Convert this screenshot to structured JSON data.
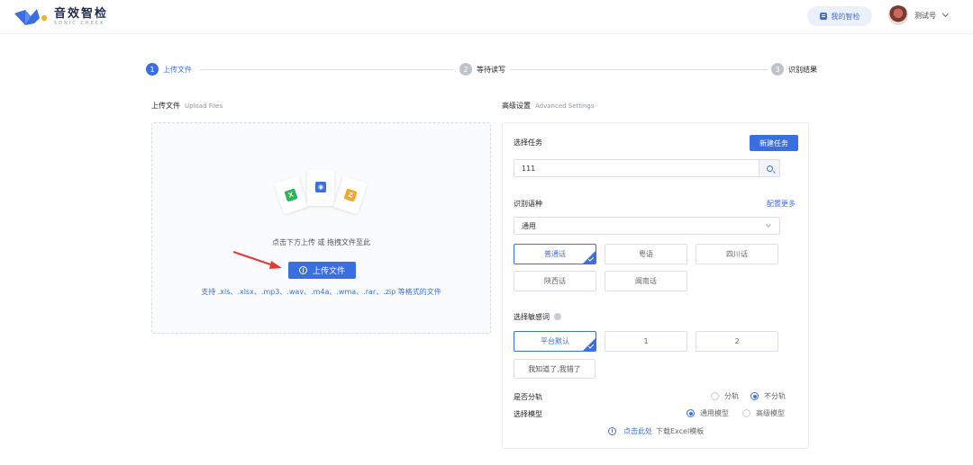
{
  "header": {
    "logo_cn": "音效智检",
    "logo_en": "SONIC CHECK",
    "my_check_label": "我的智检",
    "user_name": "测试号"
  },
  "steps": [
    {
      "num": "1",
      "label": "上传文件",
      "active": true
    },
    {
      "num": "2",
      "label": "等待读写",
      "active": false
    },
    {
      "num": "3",
      "label": "识别结果",
      "active": false
    }
  ],
  "upload": {
    "title": "上传文件",
    "title_en": "Upload Files",
    "hint": "点击下方上传 或 拖拽文件至此",
    "button_label": "上传文件",
    "formats": "支持 .xls、.xlsx、.mp3、.wav、.m4a、.wma、.rar、.zip 等格式的文件",
    "file_badges": [
      "X",
      "◉",
      "Z"
    ]
  },
  "advanced": {
    "title": "高级设置",
    "title_en": "Advanced Settings",
    "task_label": "选择任务",
    "new_task_label": "新建任务",
    "task_value": "111",
    "dialect_label": "识别语种",
    "more_label": "配置更多",
    "dialect_select": "通用",
    "dialects": [
      "普通话",
      "粤语",
      "四川话",
      "陕西话",
      "闽南话"
    ],
    "sensitive_label": "选择敏感词",
    "sensitive_opts": [
      "平台默认",
      "1",
      "2"
    ],
    "know_label": "我知道了,我错了",
    "split_label": "是否分轨",
    "split_opts": [
      "分轨",
      "不分轨"
    ],
    "model_label": "选择模型",
    "model_opts": [
      "通用模型",
      "高级模型"
    ],
    "download_link": "点击此处",
    "download_text": "下载Excel模板"
  },
  "colors": {
    "accent": "#3a6fe0",
    "excel": "#2fb35a",
    "audio": "#3a6fe0",
    "zip": "#f2a531",
    "arrow": "#e53935"
  }
}
